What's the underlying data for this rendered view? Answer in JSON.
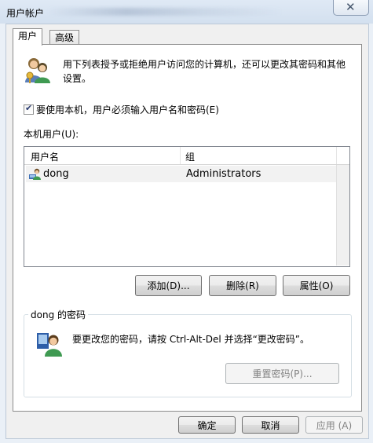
{
  "window": {
    "title": "用户帐户",
    "close_glyph": "✕"
  },
  "tabs": [
    {
      "label": "用户",
      "active": true
    },
    {
      "label": "高级",
      "active": false
    }
  ],
  "users_tab": {
    "description": "用下列表授予或拒绝用户访问您的计算机，还可以更改其密码和其他设置。",
    "require_login_checkbox": {
      "label": "要使用本机，用户必须输入用户名和密码(E)",
      "checked": true
    },
    "local_users_label": "本机用户(U):",
    "list": {
      "columns": [
        "用户名",
        "组"
      ],
      "rows": [
        {
          "username": "dong",
          "group": "Administrators",
          "icon": "user-account-icon"
        }
      ]
    },
    "buttons": {
      "add": "添加(D)...",
      "remove": "删除(R)",
      "properties": "属性(O)"
    },
    "password_group": {
      "title": "dong 的密码",
      "text": "要更改您的密码，请按 Ctrl-Alt-Del 并选择“更改密码”。",
      "reset_button": "重置密码(P)..."
    }
  },
  "dialog_buttons": {
    "ok": "确定",
    "cancel": "取消",
    "apply": "应用 (A)"
  },
  "colors": {
    "titlebar": "#dfe9f5",
    "dialog_bg": "#f0f0f0",
    "selected_row": "#f2f2f2"
  }
}
